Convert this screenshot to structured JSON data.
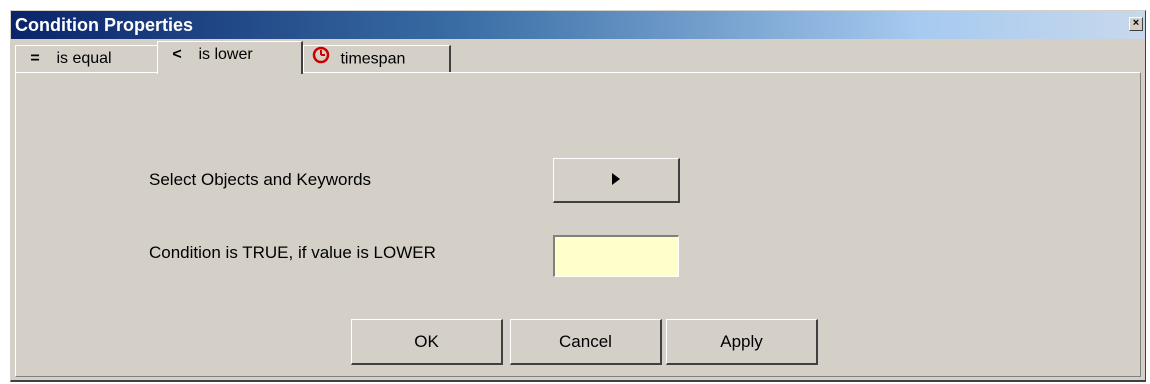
{
  "window": {
    "title": "Condition Properties",
    "close_glyph": "×"
  },
  "tabs": [
    {
      "icon_glyph": "=",
      "label": "is equal",
      "active": false
    },
    {
      "icon_glyph": "<",
      "label": "is lower",
      "active": true
    },
    {
      "icon": "clock-icon",
      "label": "timespan",
      "active": false
    }
  ],
  "form": {
    "select_label": "Select Objects and Keywords",
    "condition_label": "Condition is TRUE, if value is LOWER",
    "condition_value": ""
  },
  "buttons": {
    "ok": "OK",
    "cancel": "Cancel",
    "apply": "Apply"
  },
  "colors": {
    "title_bar_start": "#0a246a",
    "dialog_face": "#d4d0c8",
    "input_background": "#ffffcc",
    "clock_icon": "#cc0000"
  }
}
